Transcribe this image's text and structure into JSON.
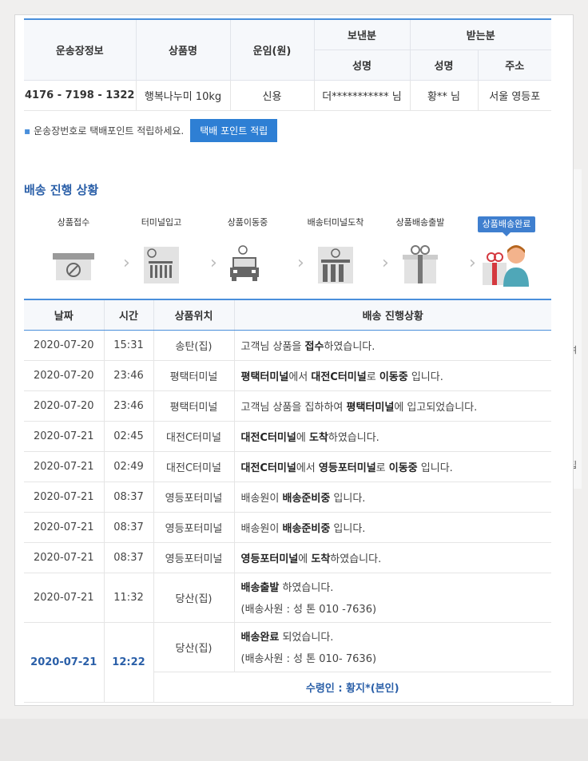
{
  "invoice": {
    "headers": {
      "tracking": "운송장정보",
      "product": "상품명",
      "fare": "운임(원)",
      "sender": "보낸분",
      "receiver": "받는분",
      "name": "성명",
      "name2": "성명",
      "address": "주소"
    },
    "row": {
      "tracking": "4176 - 7198 - 1322",
      "product": "행복나누미 10kg",
      "fare": "신용",
      "sender_name": "더*********** 님",
      "receiver_name": "황** 님",
      "receiver_address": "서울 영등포"
    }
  },
  "point": {
    "text": "운송장번호로 택배포인트 적립하세요.",
    "button": "택배 포인트 적립"
  },
  "section_title": "배송 진행 상황",
  "steps": [
    {
      "label": "상품접수",
      "icon": "counter-icon"
    },
    {
      "label": "터미널입고",
      "icon": "terminal-icon"
    },
    {
      "label": "상품이동중",
      "icon": "truck-icon"
    },
    {
      "label": "배송터미널도착",
      "icon": "terminal-icon"
    },
    {
      "label": "상품배송출발",
      "icon": "gift-icon"
    },
    {
      "label": "상품배송완료",
      "icon": "gift-person-icon",
      "active": true
    }
  ],
  "tracking": {
    "headers": {
      "date": "날짜",
      "time": "시간",
      "location": "상품위치",
      "status": "배송 진행상황"
    },
    "rows": [
      {
        "date": "2020-07-20",
        "time": "15:31",
        "location": "송탄(집)",
        "status": [
          "고객님 상품을 ",
          "접수",
          "하였습니다."
        ]
      },
      {
        "date": "2020-07-20",
        "time": "23:46",
        "location": "평택터미널",
        "status": [
          "",
          "평택터미널",
          "에서 ",
          "대전C터미널",
          "로 ",
          "이동중",
          " 입니다."
        ]
      },
      {
        "date": "2020-07-20",
        "time": "23:46",
        "location": "평택터미널",
        "status": [
          "고객님 상품을 집하하여 ",
          "평택터미널",
          "에 입고되었습니다."
        ]
      },
      {
        "date": "2020-07-21",
        "time": "02:45",
        "location": "대전C터미널",
        "status": [
          "",
          "대전C터미널",
          "에 ",
          "도착",
          "하였습니다."
        ]
      },
      {
        "date": "2020-07-21",
        "time": "02:49",
        "location": "대전C터미널",
        "status": [
          "",
          "대전C터미널",
          "에서 ",
          "영등포터미널",
          "로 ",
          "이동중",
          " 입니다."
        ]
      },
      {
        "date": "2020-07-21",
        "time": "08:37",
        "location": "영등포터미널",
        "status": [
          "배송원이 ",
          "배송준비중",
          " 입니다."
        ]
      },
      {
        "date": "2020-07-21",
        "time": "08:37",
        "location": "영등포터미널",
        "status": [
          "배송원이 ",
          "배송준비중",
          " 입니다."
        ]
      },
      {
        "date": "2020-07-21",
        "time": "08:37",
        "location": "영등포터미널",
        "status": [
          "",
          "영등포터미널",
          "에 ",
          "도착",
          "하였습니다."
        ]
      }
    ],
    "out": {
      "date": "2020-07-21",
      "time": "11:32",
      "location": "당산(집)",
      "status_bold": "배송출발",
      "status_rest": " 하였습니다.",
      "courier": "(배송사원 : 성      톤 010        -7636)"
    },
    "done": {
      "date": "2020-07-21",
      "time": "12:22",
      "location": "당산(집)",
      "status_bold": "배송완료",
      "status_rest": " 되었습니다.",
      "courier": "(배송사원 : 성      톤 010-         7636)",
      "receiver": "수령인 : 황지*(본인)"
    }
  },
  "side_strip": {
    "top": "여",
    "bottom": "집"
  },
  "colors": {
    "accent": "#2e7fd4",
    "title": "#2a5fa8",
    "border": "#4a8fdb"
  }
}
